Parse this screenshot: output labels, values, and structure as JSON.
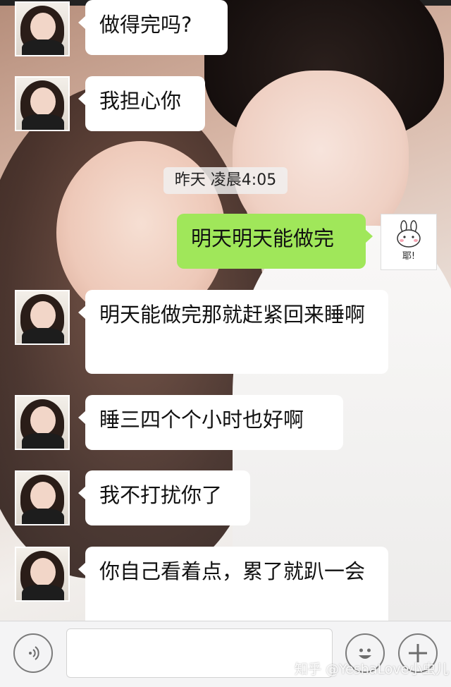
{
  "conversation": {
    "timestamp": "昨天 凌晨4:05",
    "messages": [
      {
        "side": "left",
        "text": "做得完吗?"
      },
      {
        "side": "left",
        "text": "我担心你"
      },
      {
        "side": "right",
        "text": "明天明天能做完"
      },
      {
        "side": "left",
        "text": "明天能做完那就赶紧回来睡啊"
      },
      {
        "side": "left",
        "text": "睡三四个个小时也好啊"
      },
      {
        "side": "left",
        "text": "我不打扰你了"
      },
      {
        "side": "left",
        "text": "你自己看着点，累了就趴一会"
      }
    ],
    "self_avatar_sticker_text": "耶!"
  },
  "input_bar": {
    "voice_icon": "voice-icon",
    "emoji_icon": "emoji-icon",
    "plus_icon": "plus-icon",
    "text_value": ""
  },
  "watermark": "知乎 @YeshaLove小虫儿",
  "colors": {
    "outgoing_bubble": "#a0e75a",
    "incoming_bubble": "#ffffff",
    "input_bar_bg": "#f4f4f5"
  }
}
